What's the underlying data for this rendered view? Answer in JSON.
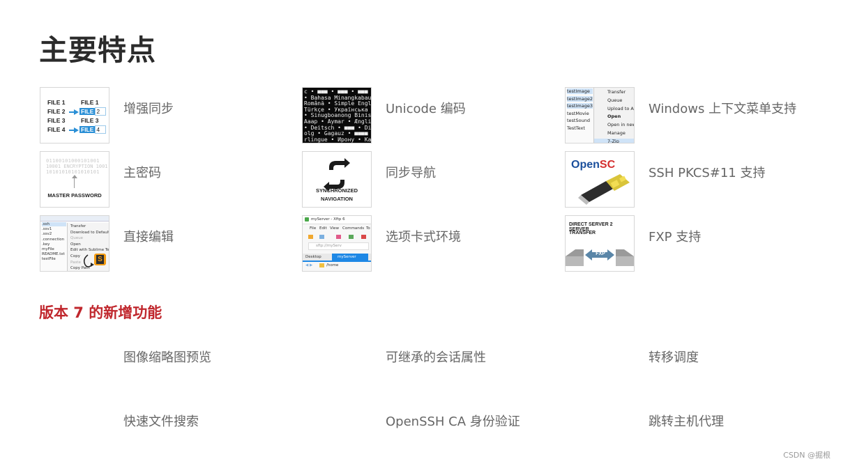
{
  "page": {
    "title": "主要特点",
    "subtitle": "版本 7 的新增功能",
    "credit": "CSDN @掘根"
  },
  "features": [
    {
      "label": "增强同步",
      "icon": "sync-files-icon",
      "thumb_text": {
        "f1": "FILE 1",
        "f2": "FILE 2",
        "f3": "FILE 3",
        "f4": "FILE 4",
        "f1r": "FILE 1",
        "f2r": "FILE",
        "f2n": "2",
        "f3r": "FILE 3",
        "f4r": "FILE",
        "f4n": "4"
      }
    },
    {
      "label": "Unicode 编码",
      "icon": "unicode-text-icon",
      "thumb_lines": [
        "c • ■■■ • ■■■ • ■■■",
        "• Bahasa Minangkabau • No",
        "Română • Simple English",
        "Türkçe • Українська • ",
        "• Sinugboanong Binisaya",
        "Aaap • Aymar • Ænglisc •",
        "• Deitsch • ■■■ • Diné B",
        "olg • Gagauz • ■■■■ • ",
        "rlingue • Ирону • Kalaa"
      ]
    },
    {
      "label": "Windows 上下文菜单支持",
      "icon": "context-menu-icon",
      "thumb_files": [
        "testImage",
        "testImage2",
        "testImage3",
        "testMovie",
        "testSound",
        "TestText"
      ],
      "thumb_menu": [
        "Transfer",
        "Queue",
        "Upload to All",
        "Open",
        "Open in new ...",
        "Manage",
        "7-Zip"
      ]
    },
    {
      "label": "主密码",
      "icon": "master-password-icon",
      "thumb_text": {
        "binary1": "01100101000101001",
        "binary2": "10001 ENCRYPTION 1001",
        "binary3": "10101010101010101",
        "caption": "MASTER PASSWORD"
      }
    },
    {
      "label": "同步导航",
      "icon": "synchronized-navigation-icon",
      "thumb_text": {
        "line1": "SYNCHRONIZED",
        "line2": "NAVIGATION"
      }
    },
    {
      "label": "SSH PKCS#11 支持",
      "icon": "opensc-smartcard-icon",
      "thumb_text": {
        "logo_a": "Open",
        "logo_b": "SC"
      }
    },
    {
      "label": "直接编辑",
      "icon": "direct-edit-icon",
      "thumb_files": [
        ".ssh",
        ".ssv1",
        ".ssv2",
        ".connection",
        ".key",
        "myFile",
        "README.txt",
        "testFile"
      ],
      "thumb_menu": [
        "Transfer",
        "Download to Default Folder",
        "Queue",
        "Open",
        "Edit with Sublime Text",
        "Copy",
        "Paste",
        "Copy Path"
      ]
    },
    {
      "label": "选项卡式环境",
      "icon": "tabbed-environment-icon",
      "thumb_text": {
        "window": "myServer - Xftp 6",
        "menu1": "File",
        "menu2": "Edit",
        "menu3": "View",
        "menu4": "Commands",
        "menu5": "To",
        "address": "sftp://myServ",
        "tab1": "Desktop",
        "tab2": "myServer",
        "path": "/home"
      }
    },
    {
      "label": "FXP 支持",
      "icon": "fxp-transfer-icon",
      "thumb_text": {
        "line1": "DIRECT SERVER 2 SERVER",
        "line2": "TRANSFER",
        "badge": "FXP"
      }
    }
  ],
  "new_features": [
    "图像缩略图预览",
    "可继承的会话属性",
    "转移调度",
    "快速文件搜索",
    "OpenSSH CA 身份验证",
    "跳转主机代理"
  ],
  "colors": {
    "accent_red": "#c0272d",
    "title": "#2b2b2b",
    "label": "#666666",
    "highlight_blue": "#2a8fd6"
  }
}
